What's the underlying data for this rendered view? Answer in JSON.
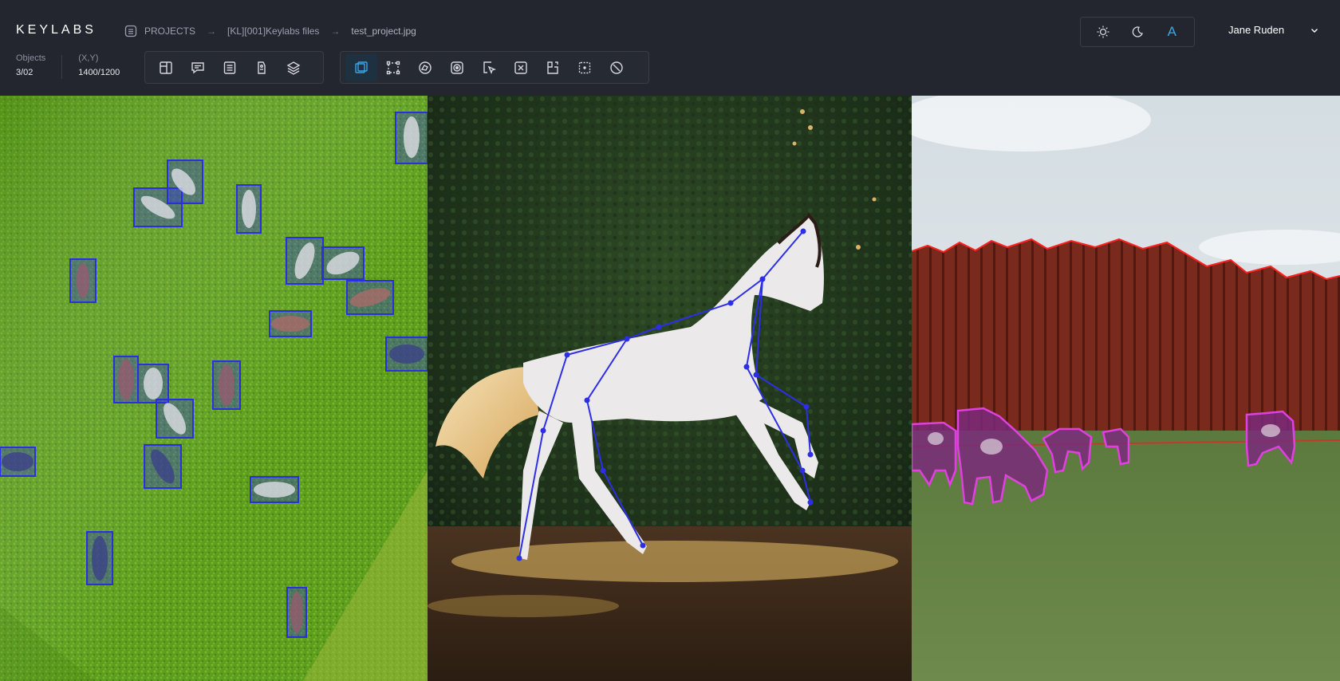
{
  "app": {
    "logo": "KEYLABS"
  },
  "breadcrumb": {
    "items": [
      "PROJECTS",
      "[KL][001]Keylabs files",
      "test_project.jpg"
    ],
    "separator": "→"
  },
  "stats": {
    "objects": {
      "label": "Objects",
      "value": "3/02"
    },
    "coords": {
      "label": "(X,Y)",
      "value": "1400/1200"
    }
  },
  "toolbar_left": [
    {
      "icon": "frame-icon"
    },
    {
      "icon": "comment-icon"
    },
    {
      "icon": "list-icon"
    },
    {
      "icon": "tag-icon"
    },
    {
      "icon": "layers-icon"
    }
  ],
  "toolbar_right": [
    {
      "icon": "bounding-box-tool-icon",
      "active": true
    },
    {
      "icon": "keypoints-tool-icon"
    },
    {
      "icon": "polygon-tool-icon"
    },
    {
      "icon": "segmentation-tool-icon"
    },
    {
      "icon": "select-cursor-icon"
    },
    {
      "icon": "text-select-icon"
    },
    {
      "icon": "cuboid-tool-icon"
    },
    {
      "icon": "mask-tool-icon"
    },
    {
      "icon": "no-annotation-icon"
    }
  ],
  "theme": {
    "light_icon": "sun-icon",
    "dark_icon": "moon-icon",
    "auto_label": "A",
    "accent": "#3aa5e0"
  },
  "user": {
    "name": "Jane Ruden"
  },
  "colors": {
    "topbar": "#23262f",
    "bbox": "#2a2fe0",
    "skeleton": "#2d2fe6",
    "polygon": "#e040e0",
    "tree_outline": "#ff2020"
  }
}
